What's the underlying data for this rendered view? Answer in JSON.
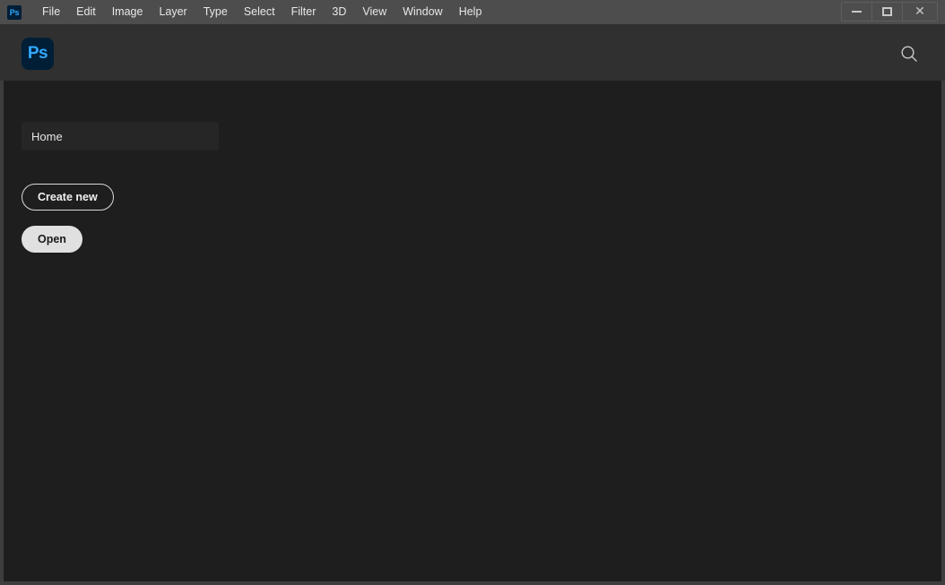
{
  "window": {
    "app_icon_label": "Ps",
    "controls": {
      "minimize_label": "Minimize",
      "maximize_label": "Maximize",
      "close_label": "Close"
    }
  },
  "menubar": {
    "items": [
      {
        "label": "File"
      },
      {
        "label": "Edit"
      },
      {
        "label": "Image"
      },
      {
        "label": "Layer"
      },
      {
        "label": "Type"
      },
      {
        "label": "Select"
      },
      {
        "label": "Filter"
      },
      {
        "label": "3D"
      },
      {
        "label": "View"
      },
      {
        "label": "Window"
      },
      {
        "label": "Help"
      }
    ]
  },
  "header": {
    "logo_label": "Ps",
    "search_icon": "search-icon"
  },
  "content": {
    "nav": {
      "home_label": "Home"
    },
    "actions": {
      "create_new_label": "Create new",
      "open_label": "Open"
    }
  },
  "colors": {
    "menubar_bg": "#4d4d4d",
    "header_bg": "#303030",
    "content_bg": "#1e1e1e",
    "frame_border": "#3d3d3d",
    "nav_item_bg": "#262626",
    "accent_blue": "#31a8ff",
    "logo_bg": "#001e36",
    "text_primary": "#e8e8e8",
    "open_button_bg": "#e0e0e0",
    "open_button_text": "#1a1a1a"
  }
}
